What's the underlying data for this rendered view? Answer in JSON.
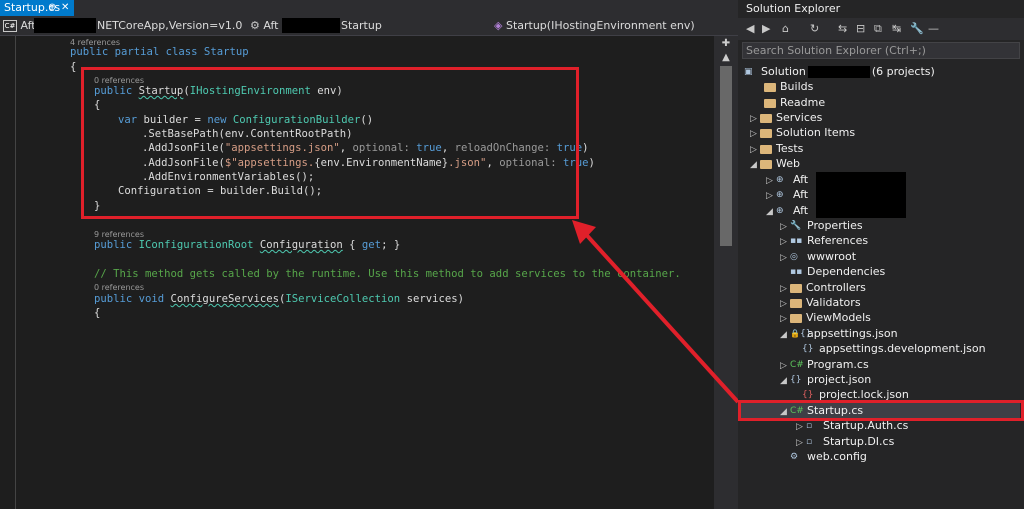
{
  "editor": {
    "tab_label": "Startup.cs",
    "tab_pin": "⊕",
    "tab_close": "✕",
    "nav": {
      "project_prefix": "Aft",
      "framework": "NETCoreApp,Version=v1.0",
      "class_prefix": "Aft",
      "class_name": "Startup",
      "member": "Startup(IHostingEnvironment env)"
    },
    "code": {
      "ref4": "4 references",
      "line_class": "public partial class Startup",
      "brace_open": "{",
      "ref0a": "0 references",
      "ctor_sig_kw": "public ",
      "ctor_name": "Startup",
      "ctor_args_open": "(",
      "ctor_arg_type": "IHostingEnvironment",
      "ctor_arg_name": " env)",
      "ctor_brace": "{",
      "l_var": "var",
      "l_builder": " builder = ",
      "l_new": "new",
      "l_cb": "ConfigurationBuilder",
      "l_cb_end": "()",
      "l_setbase": ".SetBasePath(env.ContentRootPath)",
      "l_add1_a": ".AddJsonFile(",
      "l_add1_s": "\"appsettings.json\"",
      "l_add1_b": ", ",
      "l_add1_p1": "optional:",
      "l_add1_t1": "true",
      "l_add1_c": ", ",
      "l_add1_p2": "reloadOnChange:",
      "l_add1_t2": "true",
      "l_add1_e": ")",
      "l_add2_a": ".AddJsonFile(",
      "l_add2_s1": "$\"appsettings.",
      "l_add2_i": "{env.EnvironmentName}",
      "l_add2_s2": ".json\"",
      "l_add2_b": ", ",
      "l_add2_p": "optional:",
      "l_add2_t": "true",
      "l_add2_e": ")",
      "l_env": ".AddEnvironmentVariables();",
      "l_conf": "Configuration = builder.Build();",
      "ctor_close": "}",
      "ref9": "9 references",
      "prop_kw": "public ",
      "prop_type": "IConfigurationRoot",
      "prop_name": "Configuration",
      "prop_acc": " { ",
      "prop_get": "get",
      "prop_end": "; }",
      "comment": "// This method gets called by the runtime. Use this method to add services to the container.",
      "ref0b": "0 references",
      "cs_kw": "public void ",
      "cs_name": "ConfigureServices",
      "cs_open": "(",
      "cs_type": "IServiceCollection",
      "cs_arg": " services)",
      "cs_brace": "{"
    }
  },
  "solution_explorer": {
    "title": "Solution Explorer",
    "search_placeholder": "Search Solution Explorer (Ctrl+;)",
    "toolbar": [
      "◀",
      "▶",
      "⌂",
      "↻",
      "⇆",
      "⊟",
      "⧉",
      "↹",
      "🔧",
      "—"
    ],
    "items": [
      {
        "label": "Solution",
        "suffix": "(6 projects)"
      },
      {
        "label": "Builds"
      },
      {
        "label": "Readme"
      },
      {
        "label": "Services"
      },
      {
        "label": "Solution Items"
      },
      {
        "label": "Tests"
      },
      {
        "label": "Web"
      },
      {
        "label": "Aft"
      },
      {
        "label": "Aft"
      },
      {
        "label": "Aft"
      },
      {
        "label": "Properties"
      },
      {
        "label": "References"
      },
      {
        "label": "wwwroot"
      },
      {
        "label": "Dependencies"
      },
      {
        "label": "Controllers"
      },
      {
        "label": "Validators"
      },
      {
        "label": "ViewModels"
      },
      {
        "label": "appsettings.json"
      },
      {
        "label": "appsettings.development.json"
      },
      {
        "label": "Program.cs"
      },
      {
        "label": "project.json"
      },
      {
        "label": "project.lock.json"
      },
      {
        "label": "Startup.cs"
      },
      {
        "label": "Startup.Auth.cs"
      },
      {
        "label": "Startup.DI.cs"
      },
      {
        "label": "web.config"
      }
    ]
  },
  "colors": {
    "accent": "#007acc",
    "highlight": "#e0202a"
  }
}
